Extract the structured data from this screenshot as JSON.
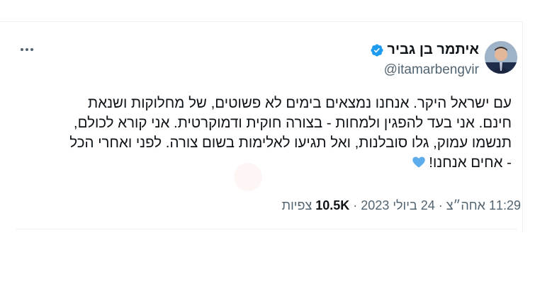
{
  "author": {
    "name": "איתמר בן גביר",
    "handle": "@itamarbengvir",
    "verified": true,
    "verified_color": "#1d9bf0"
  },
  "tweet": {
    "lines": [
      "עם ישראל היקר. אנחנו נמצאים בימים לא פשוטים, של מחלוקות ושנאת",
      "חינם. אני בעד להפגין ולמחות - בצורה חוקית ודמוקרטית. אני קורא לכולם,",
      "תנשמו עמוק, גלו סובלנות, ואל תגיעו לאלימות בשום צורה. לפני ואחרי הכל",
      "- אחים אנחנו!"
    ],
    "emoji": "blue-heart-icon",
    "emoji_color": "#5dadec"
  },
  "meta": {
    "time": "11:29 אחה״צ",
    "date": "24 ביולי 2023",
    "views_count": "10.5K",
    "views_label": "צפיות",
    "separator": "·"
  },
  "colors": {
    "text": "#0f1419",
    "secondary": "#536471",
    "border": "#eff3f4"
  }
}
